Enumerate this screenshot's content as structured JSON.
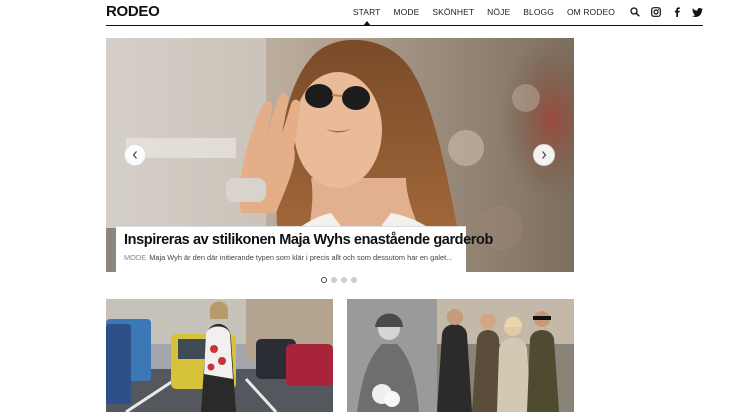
{
  "header": {
    "logo": "RODEO",
    "nav": [
      {
        "label": "START",
        "active": true
      },
      {
        "label": "MODE",
        "active": false
      },
      {
        "label": "SKÖNHET",
        "active": false
      },
      {
        "label": "NÖJE",
        "active": false
      },
      {
        "label": "BLOGG",
        "active": false
      },
      {
        "label": "OM RODEO",
        "active": false
      }
    ],
    "icons": [
      "search-icon",
      "instagram-icon",
      "facebook-icon",
      "twitter-icon"
    ]
  },
  "hero": {
    "title": "Inspireras av stilikonen Maja Wyhs enastående garderob",
    "category": "MODE",
    "excerpt": "Maja Wyh är den där initierande typen som klär i precis allt och som dessutom har en galet...",
    "slides": 4,
    "active_slide": 1
  },
  "colors": {
    "text": "#111111",
    "dot_inactive": "#cccccc"
  }
}
